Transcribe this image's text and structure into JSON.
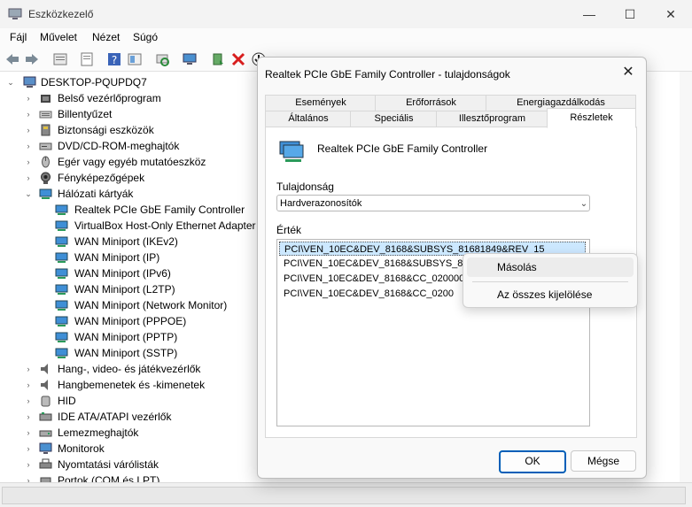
{
  "app": {
    "title": "Eszközkezelő"
  },
  "window_controls": {
    "minimize": "—",
    "maximize": "☐",
    "close": "✕"
  },
  "menu": [
    "Fájl",
    "Művelet",
    "Nézet",
    "Súgó"
  ],
  "tree": {
    "root": "DESKTOP-PQUPDQ7",
    "categories": [
      {
        "label": "Belső vezérlőprogram",
        "icon": "firmware-icon"
      },
      {
        "label": "Billentyűzet",
        "icon": "keyboard-icon"
      },
      {
        "label": "Biztonsági eszközök",
        "icon": "security-device-icon"
      },
      {
        "label": "DVD/CD-ROM-meghajtók",
        "icon": "dvd-drive-icon"
      },
      {
        "label": "Egér vagy egyéb mutatóeszköz",
        "icon": "mouse-icon"
      },
      {
        "label": "Fényképezőgépek",
        "icon": "camera-icon"
      },
      {
        "label": "Hálózati kártyák",
        "icon": "network-adapter-icon",
        "expanded": true,
        "children": [
          "Realtek PCIe GbE Family Controller",
          "VirtualBox Host-Only Ethernet Adapter",
          "WAN Miniport (IKEv2)",
          "WAN Miniport (IP)",
          "WAN Miniport (IPv6)",
          "WAN Miniport (L2TP)",
          "WAN Miniport (Network Monitor)",
          "WAN Miniport (PPPOE)",
          "WAN Miniport (PPTP)",
          "WAN Miniport (SSTP)"
        ]
      },
      {
        "label": "Hang-, video- és játékvezérlők",
        "icon": "sound-icon"
      },
      {
        "label": "Hangbemenetek és -kimenetek",
        "icon": "audio-io-icon"
      },
      {
        "label": "HID",
        "icon": "hid-icon"
      },
      {
        "label": "IDE ATA/ATAPI vezérlők",
        "icon": "ide-controller-icon"
      },
      {
        "label": "Lemezmeghajtók",
        "icon": "disk-drive-icon"
      },
      {
        "label": "Monitorok",
        "icon": "monitor-icon"
      },
      {
        "label": "Nyomtatási várólisták",
        "icon": "print-queue-icon"
      },
      {
        "label": "Portok (COM és LPT)",
        "icon": "port-icon"
      }
    ]
  },
  "dialog": {
    "title": "Realtek PCIe GbE Family Controller - tulajdonságok",
    "close": "✕",
    "tabs_row1": [
      "Események",
      "Erőforrások",
      "Energiagazdálkodás"
    ],
    "tabs_row2": [
      "Általános",
      "Speciális",
      "Illesztőprogram",
      "Részletek"
    ],
    "active_tab": "Részletek",
    "device_name": "Realtek PCIe GbE Family Controller",
    "property_label": "Tulajdonság",
    "property_value": "Hardverazonosítók",
    "values_label": "Érték",
    "values": [
      "PCI\\VEN_10EC&DEV_8168&SUBSYS_81681849&REV_15",
      "PCI\\VEN_10EC&DEV_8168&SUBSYS_816",
      "PCI\\VEN_10EC&DEV_8168&CC_020000",
      "PCI\\VEN_10EC&DEV_8168&CC_0200"
    ],
    "ok": "OK",
    "cancel": "Mégse"
  },
  "context_menu": {
    "copy": "Másolás",
    "select_all": "Az összes kijelölése"
  },
  "colors": {
    "accent": "#005fb8",
    "selection": "#cce8ff"
  }
}
